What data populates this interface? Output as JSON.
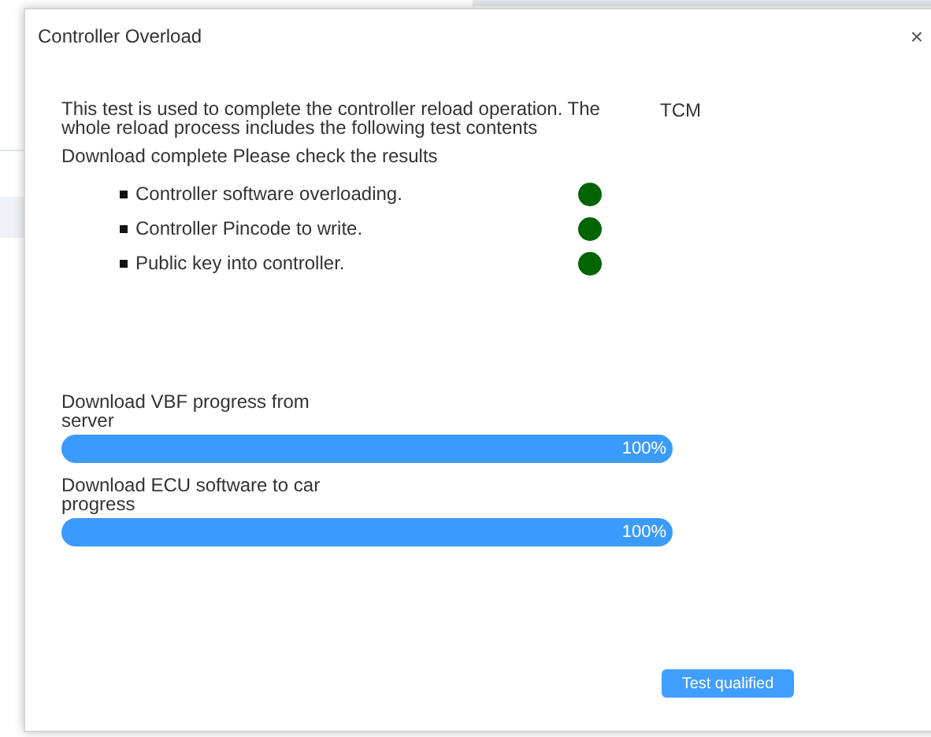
{
  "dialog": {
    "title": "Controller Overload",
    "close": "×"
  },
  "intro": "This test is used to complete the controller reload operation. The whole reload process includes the following test contents",
  "module": "TCM",
  "status_text": "Download complete Please check the results",
  "steps": [
    {
      "label": "Controller software overloading.",
      "passed": true
    },
    {
      "label": "Controller Pincode to write.",
      "passed": true
    },
    {
      "label": "Public key into controller.",
      "passed": true
    }
  ],
  "progress": [
    {
      "label": "Download VBF progress from server",
      "level": 1,
      "reading": "100%"
    },
    {
      "label": "Download ECU software to car progress",
      "level": 1,
      "reading": "100%"
    }
  ],
  "button": "Test qualified"
}
